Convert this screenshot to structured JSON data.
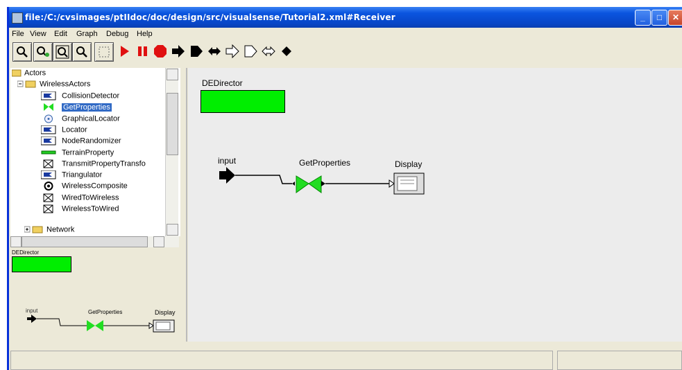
{
  "window": {
    "title": "file:/C:/cvsimages/ptIIdoc/doc/design/src/visualsense/Tutorial2.xml#Receiver",
    "controls": [
      "minimize",
      "maximize",
      "close"
    ]
  },
  "menu": [
    "File",
    "View",
    "Edit",
    "Graph",
    "Debug",
    "Help"
  ],
  "toolbar": [
    {
      "icon": "zoom-in-icon"
    },
    {
      "icon": "zoom-reset-icon"
    },
    {
      "icon": "zoom-fit-icon"
    },
    {
      "icon": "zoom-out-icon"
    },
    {
      "icon": "fullscreen-icon"
    },
    {
      "icon": "run-icon"
    },
    {
      "icon": "pause-icon"
    },
    {
      "icon": "stop-icon"
    },
    {
      "icon": "port-input-icon"
    },
    {
      "icon": "port-output-icon"
    },
    {
      "icon": "port-inout-icon"
    },
    {
      "icon": "multiport-input-icon"
    },
    {
      "icon": "multiport-output-icon"
    },
    {
      "icon": "multiport-inout-icon"
    },
    {
      "icon": "relation-diamond-icon"
    }
  ],
  "tree": {
    "root": "Actors",
    "folder": "WirelessActors",
    "items": [
      "CollisionDetector",
      "GetProperties",
      "GraphicalLocator",
      "Locator",
      "NodeRandomizer",
      "TerrainProperty",
      "TransmitPropertyTransfo",
      "Triangulator",
      "WirelessComposite",
      "WiredToWireless",
      "WirelessToWired"
    ],
    "selected": "GetProperties",
    "network": "Network"
  },
  "diagram": {
    "director": "DEDirector",
    "input": "input",
    "actor": "GetProperties",
    "display": "Display"
  },
  "colors": {
    "director": "#00ee00",
    "actor": "#22dd22",
    "selection": "#316ac5",
    "titlebar": "#0a55df"
  }
}
